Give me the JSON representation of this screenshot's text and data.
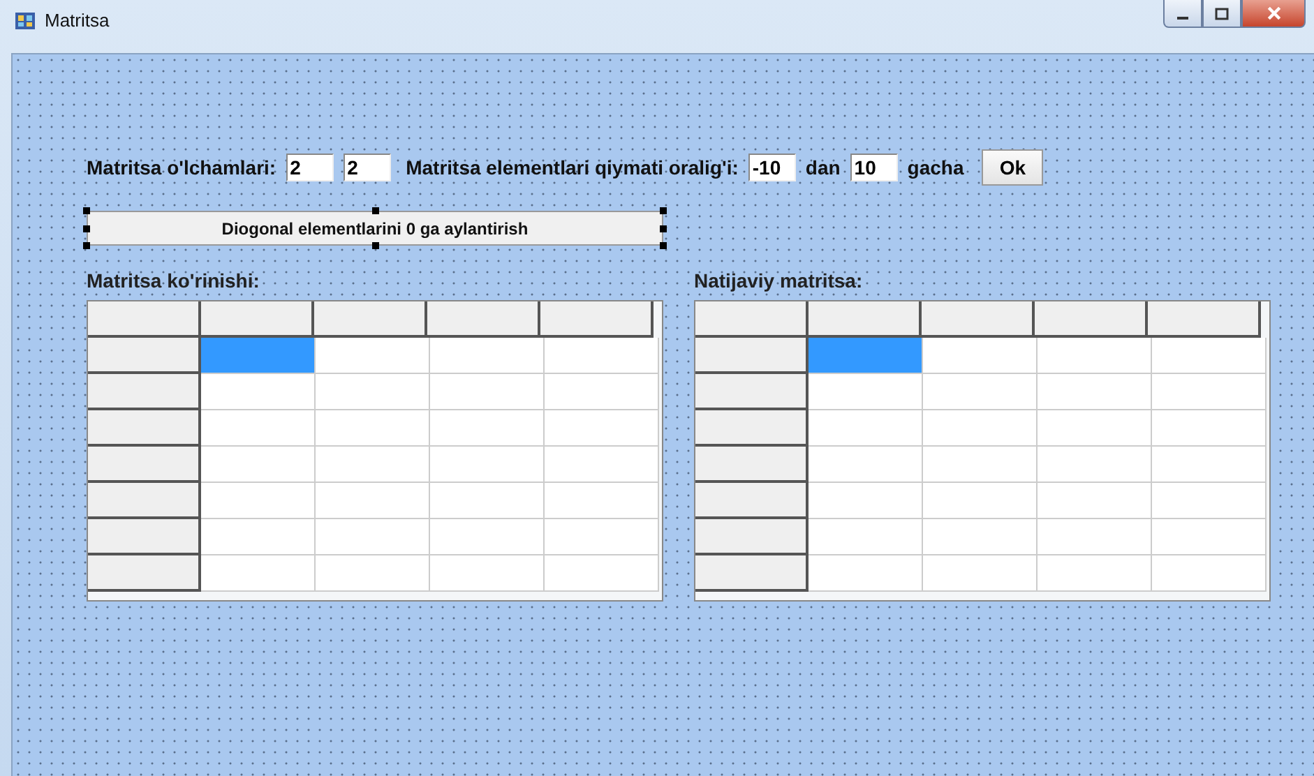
{
  "window": {
    "title": "Matritsa"
  },
  "size_row": {
    "label": "Matritsa o'lchamlari:",
    "fields": [
      "2",
      "2"
    ]
  },
  "range_row": {
    "label": "Matritsa elementlari qiymati oralig'i:",
    "from": "-10",
    "middle": "dan",
    "to": "10",
    "suffix": "gacha",
    "ok": "Ok"
  },
  "action_button": {
    "label": "Diogonal elementlarini 0 ga aylantirish",
    "selected": true
  },
  "grids": [
    {
      "label": "Matritsa ko'rinishi:",
      "rows": [
        {
          "cells": [
            {
              "selected": true
            },
            {
              "selected": false
            },
            {
              "selected": false
            },
            {
              "selected": false
            }
          ]
        },
        {
          "cells": [
            {
              "selected": false
            },
            {
              "selected": false
            },
            {
              "selected": false
            },
            {
              "selected": false
            }
          ]
        },
        {
          "cells": [
            {
              "selected": false
            },
            {
              "selected": false
            },
            {
              "selected": false
            },
            {
              "selected": false
            }
          ]
        },
        {
          "cells": [
            {
              "selected": false
            },
            {
              "selected": false
            },
            {
              "selected": false
            },
            {
              "selected": false
            }
          ]
        },
        {
          "cells": [
            {
              "selected": false
            },
            {
              "selected": false
            },
            {
              "selected": false
            },
            {
              "selected": false
            }
          ]
        },
        {
          "cells": [
            {
              "selected": false
            },
            {
              "selected": false
            },
            {
              "selected": false
            },
            {
              "selected": false
            }
          ]
        },
        {
          "cells": [
            {
              "selected": false
            },
            {
              "selected": false
            },
            {
              "selected": false
            },
            {
              "selected": false
            }
          ]
        }
      ]
    },
    {
      "label": "Natijaviy matritsa:",
      "rows": [
        {
          "cells": [
            {
              "selected": true
            },
            {
              "selected": false
            },
            {
              "selected": false
            },
            {
              "selected": false
            }
          ]
        },
        {
          "cells": [
            {
              "selected": false
            },
            {
              "selected": false
            },
            {
              "selected": false
            },
            {
              "selected": false
            }
          ]
        },
        {
          "cells": [
            {
              "selected": false
            },
            {
              "selected": false
            },
            {
              "selected": false
            },
            {
              "selected": false
            }
          ]
        },
        {
          "cells": [
            {
              "selected": false
            },
            {
              "selected": false
            },
            {
              "selected": false
            },
            {
              "selected": false
            }
          ]
        },
        {
          "cells": [
            {
              "selected": false
            },
            {
              "selected": false
            },
            {
              "selected": false
            },
            {
              "selected": false
            }
          ]
        },
        {
          "cells": [
            {
              "selected": false
            },
            {
              "selected": false
            },
            {
              "selected": false
            },
            {
              "selected": false
            }
          ]
        },
        {
          "cells": [
            {
              "selected": false
            },
            {
              "selected": false
            },
            {
              "selected": false
            },
            {
              "selected": false
            }
          ]
        }
      ]
    }
  ]
}
